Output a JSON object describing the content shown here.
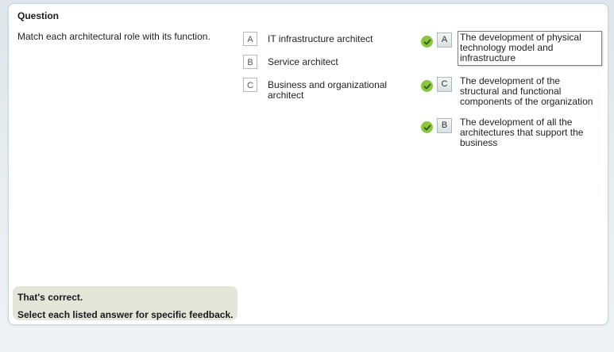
{
  "question": {
    "title": "Question",
    "prompt": "Match each architectural role with its function."
  },
  "sources": [
    {
      "letter": "A",
      "label": "IT infrastructure architect"
    },
    {
      "letter": "B",
      "label": "Service architect"
    },
    {
      "letter": "C",
      "label": "Business and organizational architect"
    }
  ],
  "targets": [
    {
      "selected": "A",
      "status": "correct",
      "text": "The development of physical technology model and infrastructure"
    },
    {
      "selected": "C",
      "status": "correct",
      "text": "The development of the structural and functional components of the organization"
    },
    {
      "selected": "B",
      "status": "correct",
      "text": "The development of all the architectures that support the business"
    }
  ],
  "feedback": {
    "result": "That's correct.",
    "hint": "Select each listed answer for specific feedback."
  },
  "colors": {
    "check": "#8cc63f",
    "feedback_bg": "#e3e6d9"
  }
}
